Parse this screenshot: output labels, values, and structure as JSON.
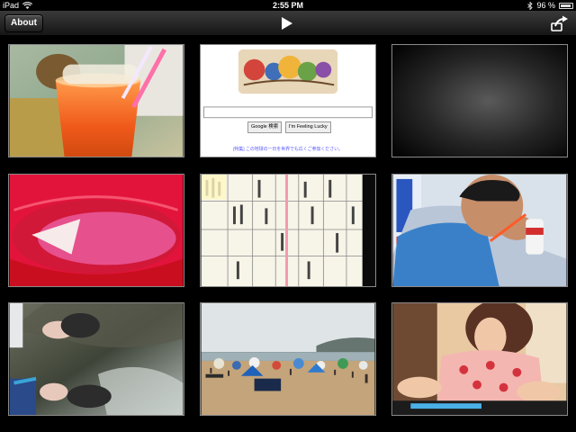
{
  "status_bar": {
    "device": "iPad",
    "time": "2:55 PM",
    "battery": "96 %",
    "wifi_icon": "wifi-icon",
    "bluetooth_icon": "bluetooth-icon",
    "battery_icon": "battery-icon"
  },
  "toolbar": {
    "about_label": "About",
    "play_icon": "play-icon",
    "action_icon": "action-icon"
  },
  "google": {
    "search_button": "Google 検索",
    "lucky_button": "I'm Feeling Lucky"
  },
  "thumbnails": [
    {
      "name": "photo-orange-drink"
    },
    {
      "name": "photo-google-homepage"
    },
    {
      "name": "photo-dark-gradient"
    },
    {
      "name": "photo-red-bowl"
    },
    {
      "name": "photo-tv-listings"
    },
    {
      "name": "photo-boy-eating"
    },
    {
      "name": "photo-feet-water"
    },
    {
      "name": "photo-crowded-beach"
    },
    {
      "name": "photo-child-table"
    }
  ]
}
